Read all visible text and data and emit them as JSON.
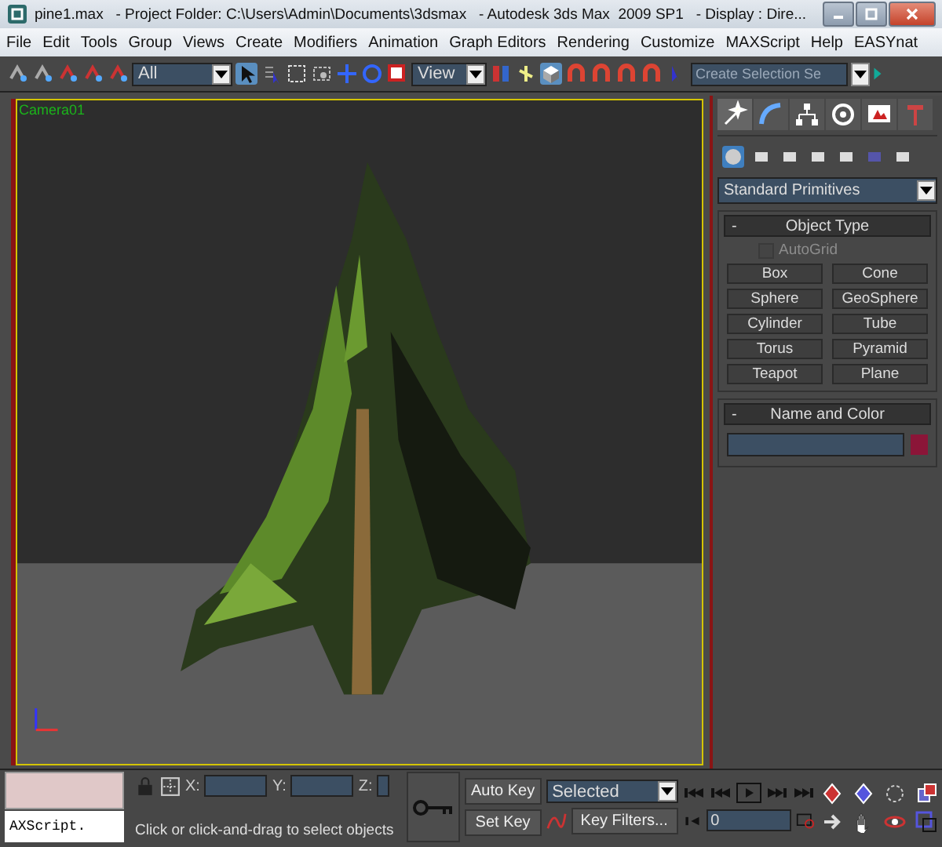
{
  "window": {
    "title": "pine1.max   - Project Folder: C:\\Users\\Admin\\Documents\\3dsmax   - Autodesk 3ds Max  2009 SP1   - Display : Dire..."
  },
  "menu": [
    "File",
    "Edit",
    "Tools",
    "Group",
    "Views",
    "Create",
    "Modifiers",
    "Animation",
    "Graph Editors",
    "Rendering",
    "Customize",
    "MAXScript",
    "Help",
    "EASYnat"
  ],
  "toolbar": {
    "selection_filter": "All",
    "reference_coordinate": "View",
    "named_selection": {
      "placeholder": "Create Selection Se"
    }
  },
  "viewport": {
    "label": "Camera01"
  },
  "command_panel": {
    "categories": [
      {
        "selected": true
      },
      {
        "selected": false
      },
      {
        "selected": false
      },
      {
        "selected": false
      },
      {
        "selected": false
      },
      {
        "selected": false
      },
      {
        "selected": false
      }
    ],
    "type_dropdown": "Standard Primitives",
    "object_type": {
      "collapse": "-",
      "title": "Object Type",
      "autogrid": {
        "label": "AutoGrid",
        "checked": false,
        "disabled": true
      },
      "buttons": [
        "Box",
        "Cone",
        "Sphere",
        "GeoSphere",
        "Cylinder",
        "Tube",
        "Torus",
        "Pyramid",
        "Teapot",
        "Plane"
      ]
    },
    "name_and_color": {
      "collapse": "-",
      "title": "Name and Color"
    }
  },
  "bottom": {
    "listener_output": "AXScript.",
    "coords": [
      "X:",
      "Y:",
      "Z:"
    ],
    "status": "Click or click-and-drag to select objects",
    "auto_key": "Auto Key",
    "key_mode": "Selected",
    "set_key": "Set Key",
    "key_filters": "Key Filters...",
    "frame": "0"
  }
}
